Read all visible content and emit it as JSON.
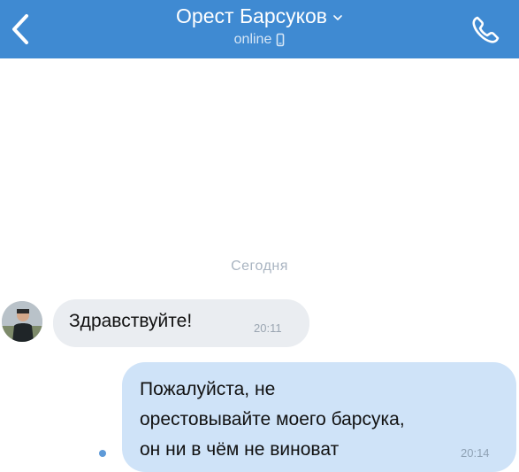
{
  "header": {
    "contact_name": "Орест Барсуков",
    "status": "online"
  },
  "chat": {
    "date_separator": "Сегодня",
    "messages": [
      {
        "direction": "incoming",
        "lines": [
          "Здравствуйте!"
        ],
        "time": "20:11"
      },
      {
        "direction": "outgoing",
        "lines": [
          "Пожалуйста, не",
          "орестовывайте моего барсука,",
          "он ни в чём не виноват"
        ],
        "time": "20:14"
      }
    ]
  },
  "colors": {
    "header_bg": "#3f8ad2",
    "incoming_bubble": "#eaedf1",
    "outgoing_bubble": "#cfe3f8",
    "unread_dot": "#5e9ad8"
  },
  "icons": {
    "back": "chevron-left-icon",
    "name_menu": "chevron-down-icon",
    "device": "mobile-phone-icon",
    "call": "phone-call-icon"
  }
}
